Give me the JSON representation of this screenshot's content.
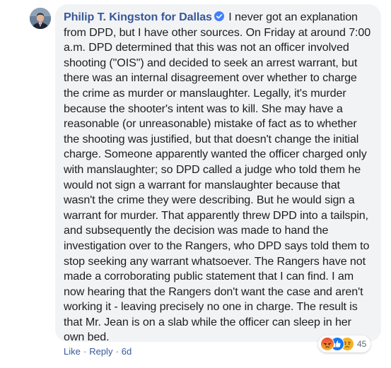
{
  "comment": {
    "author": "Philip T. Kingston for Dallas",
    "verified_icon": "verified-badge-icon",
    "text": "I never got an explanation from DPD, but I have other sources. On Friday at around 7:00 a.m. DPD determined that this was not an officer involved shooting (\"OIS\") and decided to seek an arrest warrant, but there was an internal disagreement over whether to charge the crime as murder or manslaughter. Legally, it's murder because the shooter's intent was to kill. She may have a reasonable (or unreasonable) mistake of fact as to whether the shooting was justified, but that doesn't change the initial charge. Someone apparently wanted the officer charged only with manslaughter; so DPD called a judge who told them he would not sign a warrant for manslaughter because that wasn't the crime they were describing. But he would sign a warrant for murder. That apparently threw DPD into a tailspin, and subsequently the decision was made to hand the investigation over to the Rangers, who DPD says told them to stop seeking any warrant whatsoever. The Rangers have not made a corroborating public statement that I can find. I am now hearing that the Rangers don't want the case and aren't working it - leaving precisely no one in charge. The result is that Mr. Jean is on a slab while the officer can sleep in her own bed."
  },
  "reactions": {
    "icons": [
      "angry-reaction-icon",
      "like-reaction-icon",
      "sad-reaction-icon"
    ],
    "count": "45"
  },
  "actions": {
    "like_label": "Like",
    "separator": "·",
    "reply_label": "Reply",
    "timestamp": "6d"
  },
  "colors": {
    "bubble_bg": "#f2f3f5",
    "author_link": "#385898",
    "body_text": "#1c1e21",
    "meta_text": "#606770",
    "verified_badge": "#4080ff",
    "angry": "#f4643a",
    "like": "#1877f2",
    "sad": "#f7b125"
  }
}
